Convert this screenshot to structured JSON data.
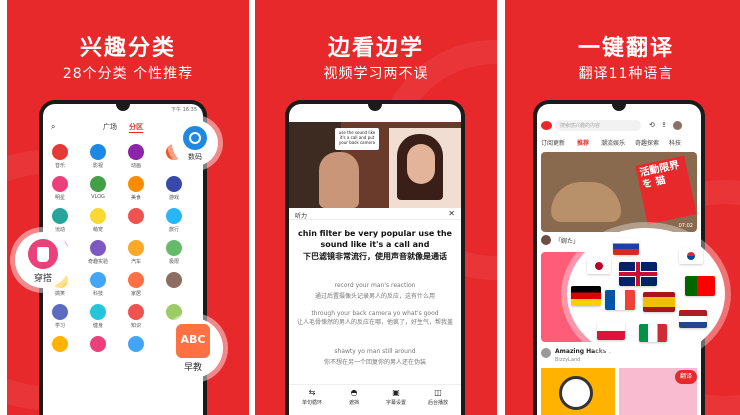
{
  "panel1": {
    "headline": "兴趣分类",
    "subtitle": "28个分类 个性推荐",
    "status_time": "下午 16:35",
    "tabs": [
      "广场",
      "分区"
    ],
    "grid_items": [
      {
        "label": "音乐",
        "color": "#e53935"
      },
      {
        "label": "影视",
        "color": "#1e88e5"
      },
      {
        "label": "动画",
        "color": "#8e24aa"
      },
      {
        "label": "",
        "color": "#f4511e"
      },
      {
        "label": "明星",
        "color": "#ec407a"
      },
      {
        "label": "VLOG",
        "color": "#43a047"
      },
      {
        "label": "美食",
        "color": "#fb8c00"
      },
      {
        "label": "游戏",
        "color": "#3949ab"
      },
      {
        "label": "运动",
        "color": "#26a69a"
      },
      {
        "label": "萌宠",
        "color": "#fdd835"
      },
      {
        "label": "",
        "color": "#ef5350"
      },
      {
        "label": "旅行",
        "color": "#29b6f6"
      },
      {
        "label": "",
        "color": "#ab47bc"
      },
      {
        "label": "奇趣实验",
        "color": "#7e57c2"
      },
      {
        "label": "汽车",
        "color": "#ffa726"
      },
      {
        "label": "极限",
        "color": "#66bb6a"
      },
      {
        "label": "搞笑",
        "color": "#ffca28"
      },
      {
        "label": "科技",
        "color": "#42a5f5"
      },
      {
        "label": "家居",
        "color": "#ff7043"
      },
      {
        "label": "",
        "color": "#8d6e63"
      },
      {
        "label": "学习",
        "color": "#5c6bc0"
      },
      {
        "label": "健身",
        "color": "#26c6da"
      },
      {
        "label": "知识",
        "color": "#ef5350"
      },
      {
        "label": "",
        "color": "#9ccc65"
      },
      {
        "label": "",
        "color": "#ffb300"
      },
      {
        "label": "",
        "color": "#ec407a"
      },
      {
        "label": "",
        "color": "#42a5f5"
      },
      {
        "label": "",
        "color": "#ab47bc"
      }
    ],
    "bubble_camera": "数码",
    "bubble_dress": "穿搭",
    "bubble_abc": "早教"
  },
  "panel2": {
    "headline": "边看边学",
    "subtitle": "视频学习两不误",
    "video_caption": "use the sound like it's a call and put your back camera",
    "listen_label": "听力",
    "main_en": "chin filter be very popular use the sound like it's a call and",
    "main_zh": "下巴滤镜非常流行，使用声音就像是通话",
    "lines": [
      {
        "en": "record your man's reaction",
        "zh": "通过后置摄像头记录男人的反应，这有什么用"
      },
      {
        "en": "through your back camera yo what's good",
        "zh": "让人毛骨悚然的男人的反应在哪，他疯了，好生气，帮我盖"
      },
      {
        "en": "shawty yo man still around",
        "zh": "你不想在另一个回复你的男人还在伪装"
      }
    ],
    "bottom_bar": [
      "单句循环",
      "遮挡",
      "字幕设置",
      "后台播放"
    ]
  },
  "panel3": {
    "headline": "一键翻译",
    "subtitle": "翻译11种语言",
    "search_placeholder": "搜索感兴趣的内容",
    "tabs": [
      "订阅更新",
      "推荐",
      "潮流娱乐",
      "奇趣探索",
      "科技"
    ],
    "cat_text": "活動限界を 猫",
    "video_duration": "07:02",
    "card_title": "Amazing Hacks with",
    "card_user": "BizzyLand",
    "translate_badge": "翻译",
    "badge_text": "「婉た」",
    "red_chip": "翻译"
  }
}
